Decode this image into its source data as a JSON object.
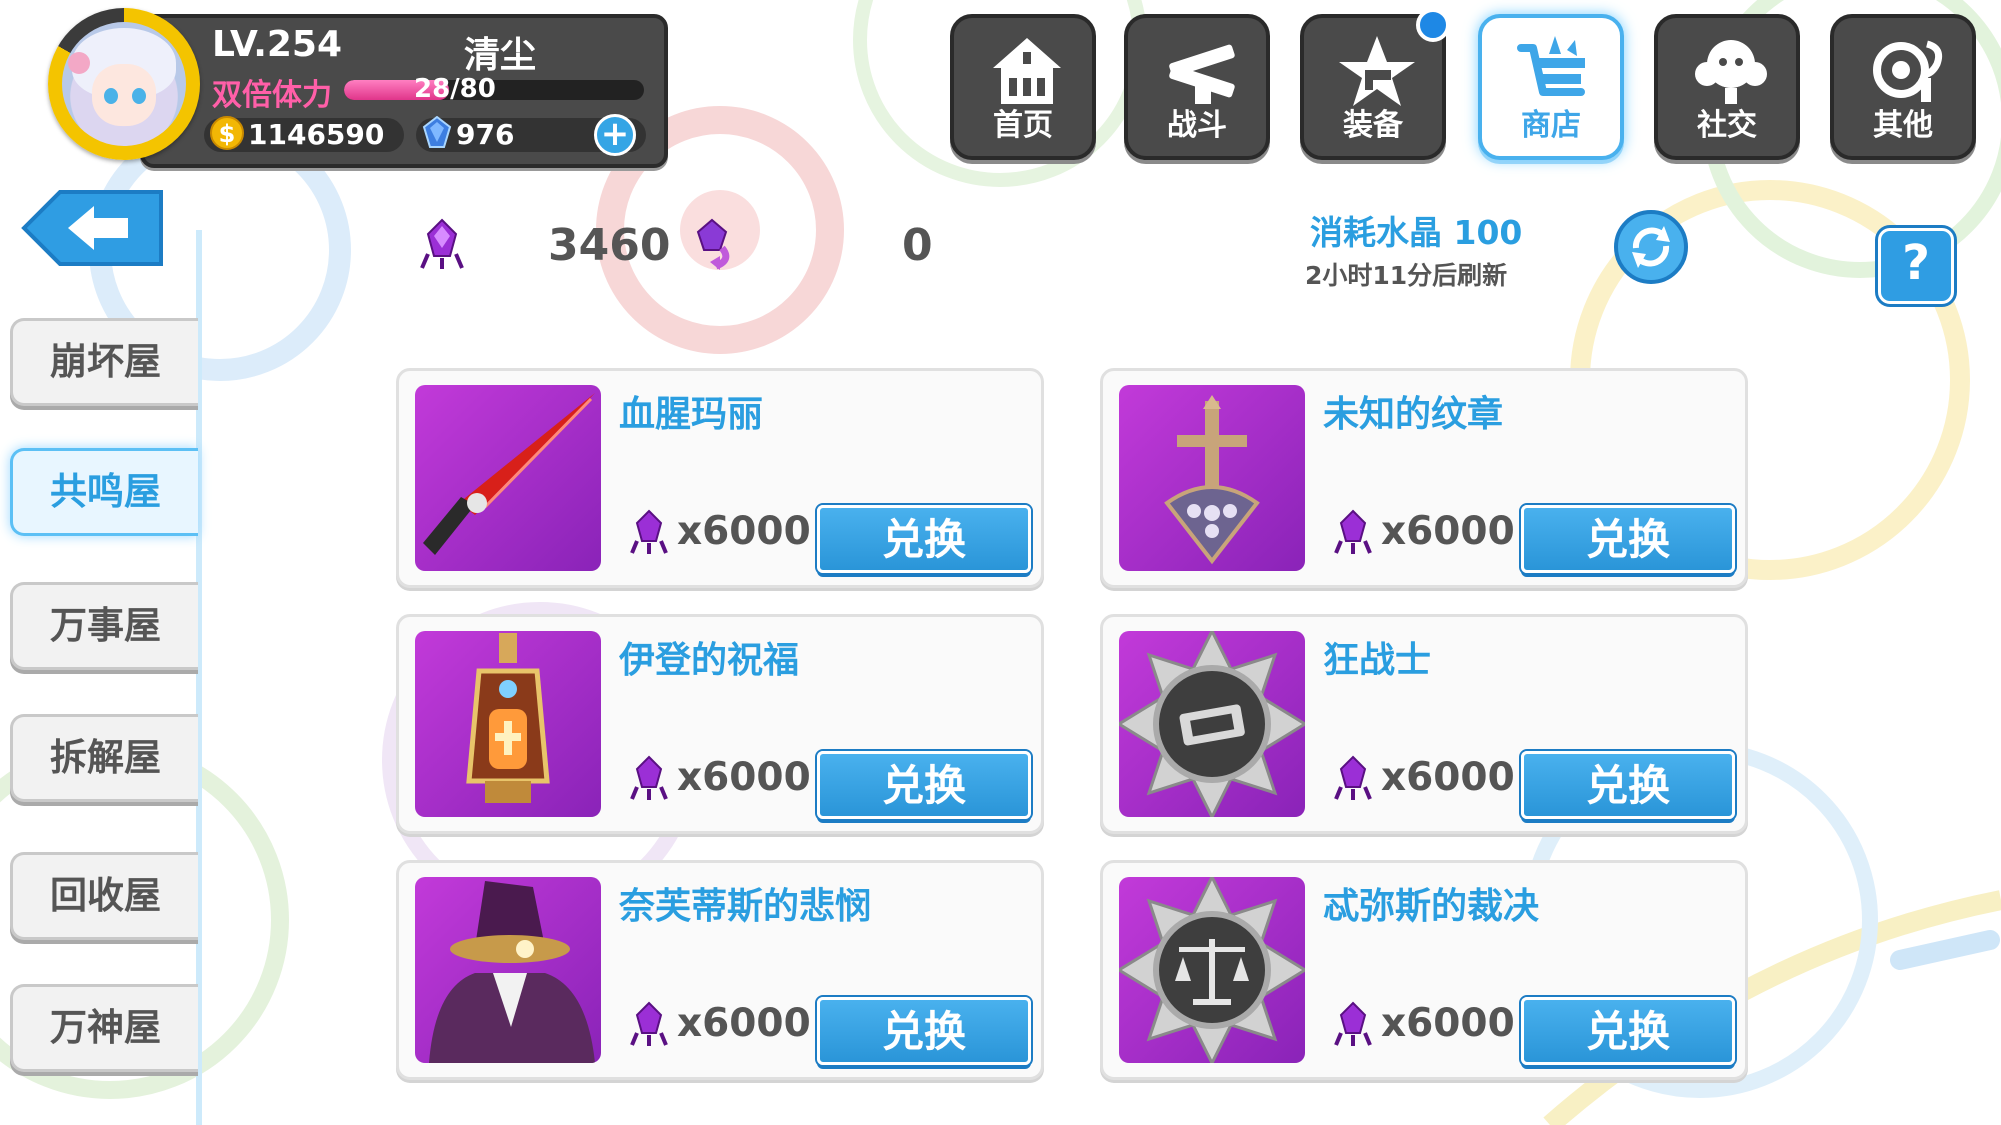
{
  "player": {
    "level": "LV.254",
    "name": "清尘",
    "stamina_label": "双倍体力",
    "stamina": "28/80",
    "stamina_fraction": 0.35,
    "gold": "1146590",
    "crystals": "976"
  },
  "nav": [
    {
      "label": "首页",
      "icon": "home-icon"
    },
    {
      "label": "战斗",
      "icon": "battle-icon"
    },
    {
      "label": "装备",
      "icon": "equipment-icon"
    },
    {
      "label": "商店",
      "icon": "shop-icon"
    },
    {
      "label": "社交",
      "icon": "social-icon"
    },
    {
      "label": "其他",
      "icon": "settings-icon"
    }
  ],
  "shop": {
    "currency_amount": "3460",
    "exchange_amount": "0",
    "refresh_cost": "消耗水晶 100",
    "refresh_time": "2小时11分后刷新",
    "help": "?"
  },
  "sidebar": [
    {
      "label": "崩坏屋"
    },
    {
      "label": "共鸣屋"
    },
    {
      "label": "万事屋"
    },
    {
      "label": "拆解屋"
    },
    {
      "label": "回收屋"
    },
    {
      "label": "万神屋"
    }
  ],
  "items": [
    {
      "name": "血腥玛丽",
      "cost": "x6000",
      "button": "兑换"
    },
    {
      "name": "未知的纹章",
      "cost": "x6000",
      "button": "兑换"
    },
    {
      "name": "伊登的祝福",
      "cost": "x6000",
      "button": "兑换"
    },
    {
      "name": "狂战士",
      "cost": "x6000",
      "button": "兑换"
    },
    {
      "name": "奈芙蒂斯的悲悯",
      "cost": "x6000",
      "button": "兑换"
    },
    {
      "name": "忒弥斯的裁决",
      "cost": "x6000",
      "button": "兑换"
    }
  ],
  "colors": {
    "accent": "#2a9ee0",
    "panel": "#4a4a4a",
    "item_bg": "#a52ccb",
    "gold": "#f2b705",
    "stamina": "#e0358a"
  }
}
